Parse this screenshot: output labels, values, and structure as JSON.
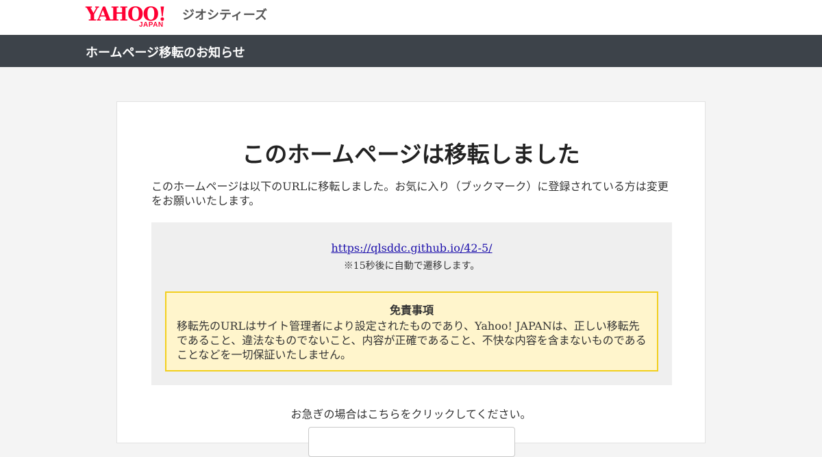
{
  "header": {
    "logo_text": "YAHOO!",
    "logo_sub": "JAPAN",
    "service_name": "ジオシティーズ",
    "brand_color": "#ff0033"
  },
  "titlebar": {
    "title": "ホームページ移転のお知らせ",
    "background": "#3d434a"
  },
  "main": {
    "heading": "このホームページは移転しました",
    "intro": "このホームページは以下のURLに移転しました。お気に入り（ブックマーク）に登録されている方は変更をお願いいたします。",
    "new_url": "https://qlsddc.github.io/42-5/",
    "redirect_note": "※15秒後に自動で遷移します。",
    "disclaimer": {
      "title": "免責事項",
      "text": "移転先のURLはサイト管理者により設定されたものであり、Yahoo! JAPANは、正しい移転先であること、違法なものでないこと、内容が正確であること、不快な内容を含まないものであることなどを一切保証いたしません。"
    },
    "hurry_text": "お急ぎの場合はこちらをクリックしてください。"
  }
}
